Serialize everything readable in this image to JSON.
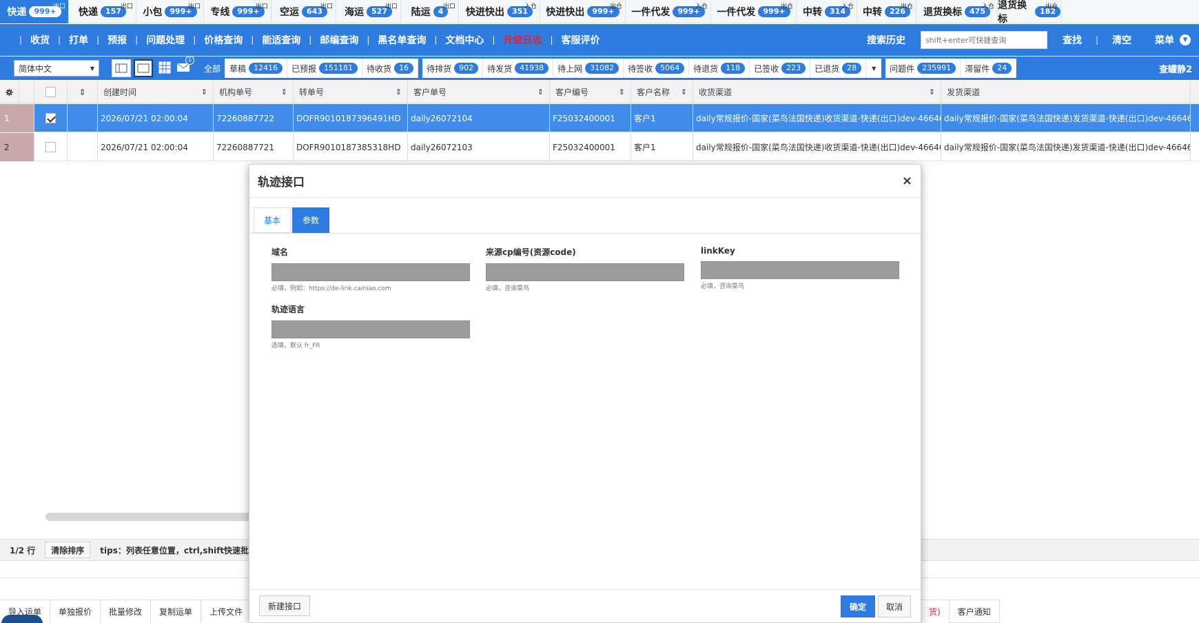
{
  "top_tabs": [
    {
      "label": "快递",
      "count": "999+",
      "tag": "出口",
      "active": true
    },
    {
      "label": "快递",
      "count": "157",
      "tag": "出口"
    },
    {
      "label": "小包",
      "count": "999+",
      "tag": "出口"
    },
    {
      "label": "专线",
      "count": "999+",
      "tag": "出口"
    },
    {
      "label": "空运",
      "count": "643",
      "tag": "出口"
    },
    {
      "label": "海运",
      "count": "527",
      "tag": "出口"
    },
    {
      "label": "陆运",
      "count": "4",
      "tag": "出口"
    },
    {
      "label": "快进快出",
      "count": "351",
      "tag": "入仓"
    },
    {
      "label": "快进快出",
      "count": "999+",
      "tag": "出仓"
    },
    {
      "label": "一件代发",
      "count": "999+",
      "tag": "入仓"
    },
    {
      "label": "一件代发",
      "count": "999+",
      "tag": "出仓"
    },
    {
      "label": "中转",
      "count": "314",
      "tag": "入仓"
    },
    {
      "label": "中转",
      "count": "226",
      "tag": "出仓"
    },
    {
      "label": "退货换标",
      "count": "475",
      "tag": "入仓"
    },
    {
      "label": "退货换标",
      "count": "182",
      "tag": "出仓"
    }
  ],
  "nav": {
    "items": [
      {
        "label": "收货"
      },
      {
        "label": "打单"
      },
      {
        "label": "预报"
      },
      {
        "label": "问题处理"
      },
      {
        "label": "价格查询"
      },
      {
        "label": "能适查询"
      },
      {
        "label": "邮编查询"
      },
      {
        "label": "黑名单查询"
      },
      {
        "label": "文档中心"
      },
      {
        "label": "升级日志",
        "highlight": true
      },
      {
        "label": "客服评价"
      }
    ],
    "search_history": "搜索历史",
    "search_placeholder": "shift+enter可快捷查询",
    "find": "查找",
    "clear": "清空",
    "menu": "菜单"
  },
  "filter": {
    "language": "简体中文",
    "mail_badge": "1",
    "group1": [
      {
        "label": "全部",
        "count": "",
        "active": true
      },
      {
        "label": "草稿",
        "count": "12416"
      },
      {
        "label": "已预报",
        "count": "151181"
      },
      {
        "label": "待收货",
        "count": "16"
      }
    ],
    "group2": [
      {
        "label": "待排货",
        "count": "902"
      },
      {
        "label": "待发货",
        "count": "41938"
      },
      {
        "label": "待上网",
        "count": "31082"
      },
      {
        "label": "待签收",
        "count": "5064"
      },
      {
        "label": "待退货",
        "count": "118"
      },
      {
        "label": "已签收",
        "count": "223"
      },
      {
        "label": "已退货",
        "count": "28"
      }
    ],
    "group3": [
      {
        "label": "问题件",
        "count": "235991"
      },
      {
        "label": "滞留件",
        "count": "24"
      }
    ],
    "right_label": "查罐静2"
  },
  "table": {
    "columns": [
      "创建时间",
      "机构单号",
      "转单号",
      "客户单号",
      "客户编号",
      "客户名称",
      "收货渠道",
      "发货渠道"
    ],
    "rows": [
      {
        "idx": "1",
        "checked": true,
        "selected": true,
        "created": "2026/07/21 02:00:04",
        "org_no": "72260887722",
        "transfer_no": "DOFR9010187396491HD",
        "customer_no": "daily26072104",
        "customer_code": "F25032400001",
        "customer_name": "客户1",
        "recv_channel": "daily常规报价-国家(菜鸟法国快递)收货渠道-快递(出口)dev-46646",
        "send_channel": "daily常规报价-国家(菜鸟法国快递)发货渠道-快递(出口)dev-46646"
      },
      {
        "idx": "2",
        "checked": false,
        "selected": false,
        "created": "2026/07/21 02:00:04",
        "org_no": "72260887721",
        "transfer_no": "DOFR9010187385318HD",
        "customer_no": "daily26072103",
        "customer_code": "F25032400001",
        "customer_name": "客户1",
        "recv_channel": "daily常规报价-国家(菜鸟法国快递)收货渠道-快递(出口)dev-46646",
        "send_channel": "daily常规报价-国家(菜鸟法国快递)发货渠道-快递(出口)dev-46646"
      }
    ]
  },
  "status": {
    "rows": "1/2 行",
    "clear_sort": "清除排序",
    "tips": "tips：列表任意位置，ctrl,shift快速批量选"
  },
  "actions": [
    {
      "label": "导入运单"
    },
    {
      "label": "单独报价"
    },
    {
      "label": "批量修改"
    },
    {
      "label": "复制运单"
    },
    {
      "label": "上传文件"
    }
  ],
  "actions_right": {
    "partial": "货)",
    "notify": "客户通知"
  },
  "modal": {
    "title": "轨迹接口",
    "close": "×",
    "tabs": [
      {
        "label": "基本"
      },
      {
        "label": "参数",
        "active": true
      }
    ],
    "fields": [
      {
        "label": "域名",
        "hint": "必填，例如：https://de-link.cainiao.com"
      },
      {
        "label": "来源cp编号(资源code)",
        "hint": "必填，咨询菜鸟"
      },
      {
        "label": "linkKey",
        "hint": "必填，咨询菜鸟"
      },
      {
        "label": "轨迹语言",
        "hint": "选填，默认 fr_FR"
      }
    ],
    "new_button": "新建接口",
    "ok": "确定",
    "cancel": "取消"
  }
}
